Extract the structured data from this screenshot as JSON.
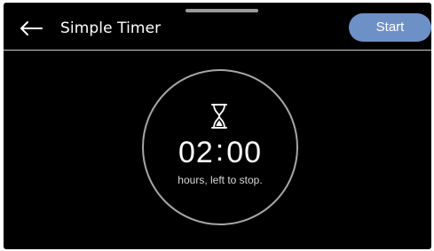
{
  "header": {
    "title": "Simple Timer",
    "start_label": "Start",
    "back_icon": "arrow-left-icon"
  },
  "timer": {
    "hours": "02",
    "separator": ":",
    "minutes": "00",
    "caption": "hours, left to stop.",
    "icon": "hourglass-icon"
  },
  "colors": {
    "background": "#000000",
    "accent": "#6d90c7",
    "ring": "#a6a6a6",
    "text": "#ffffff"
  }
}
